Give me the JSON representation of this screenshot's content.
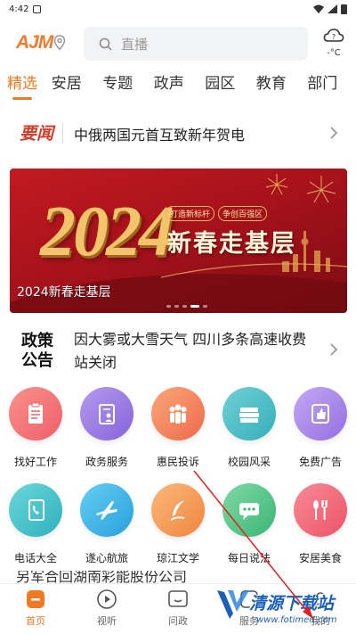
{
  "status": {
    "time": "4:42"
  },
  "header": {
    "logo": "AJM",
    "search_placeholder": "直播",
    "temperature": "-°C"
  },
  "tabs": [
    "精选",
    "安居",
    "专题",
    "政声",
    "园区",
    "教育",
    "部门"
  ],
  "headline": {
    "tag": "要闻",
    "text": "中俄两国元首互致新年贺电"
  },
  "banner": {
    "year": "2024",
    "tagline": [
      "打造新标杆",
      "争创百强区"
    ],
    "main_title": "新春走基层",
    "caption": "2024新春走基层"
  },
  "policy": {
    "tag_line1": "政策",
    "tag_line2": "公告",
    "text": "因大雾或大雪天气 四川多条高速收费站关闭"
  },
  "services": [
    {
      "label": "找好工作",
      "icon": "clipboard-icon",
      "color": "#f4746f"
    },
    {
      "label": "政务服务",
      "icon": "document-person-icon",
      "color": "#9b7ce3"
    },
    {
      "label": "惠民投诉",
      "icon": "people-icon",
      "color": "#f58a5c"
    },
    {
      "label": "校园风采",
      "icon": "books-icon",
      "color": "#4fc0c6"
    },
    {
      "label": "免费广告",
      "icon": "thumbs-up-icon",
      "color": "#a98bea"
    },
    {
      "label": "电话大全",
      "icon": "phone-book-icon",
      "color": "#45c4cc"
    },
    {
      "label": "遂心航旅",
      "icon": "airplane-icon",
      "color": "#3fb6e8"
    },
    {
      "label": "琼江文学",
      "icon": "quill-icon",
      "color": "#f7a25e"
    },
    {
      "label": "每日说法",
      "icon": "chat-bubble-icon",
      "color": "#5cc790"
    },
    {
      "label": "安居美食",
      "icon": "utensils-icon",
      "color": "#f46b7f"
    }
  ],
  "news_peek": "另军合回湖南彩能股份公司",
  "bottom_nav": [
    {
      "label": "首页",
      "icon": "home-icon"
    },
    {
      "label": "视听",
      "icon": "play-icon"
    },
    {
      "label": "问政",
      "icon": "chat-box-icon"
    },
    {
      "label": "服务",
      "icon": "service-icon"
    },
    {
      "label": "我的",
      "icon": "profile-icon"
    }
  ],
  "watermark": {
    "text": "清源下载站",
    "url": "www.fotimeit.com"
  },
  "colors": {
    "accent": "#f07a24",
    "headline_red": "#d63a2b"
  }
}
